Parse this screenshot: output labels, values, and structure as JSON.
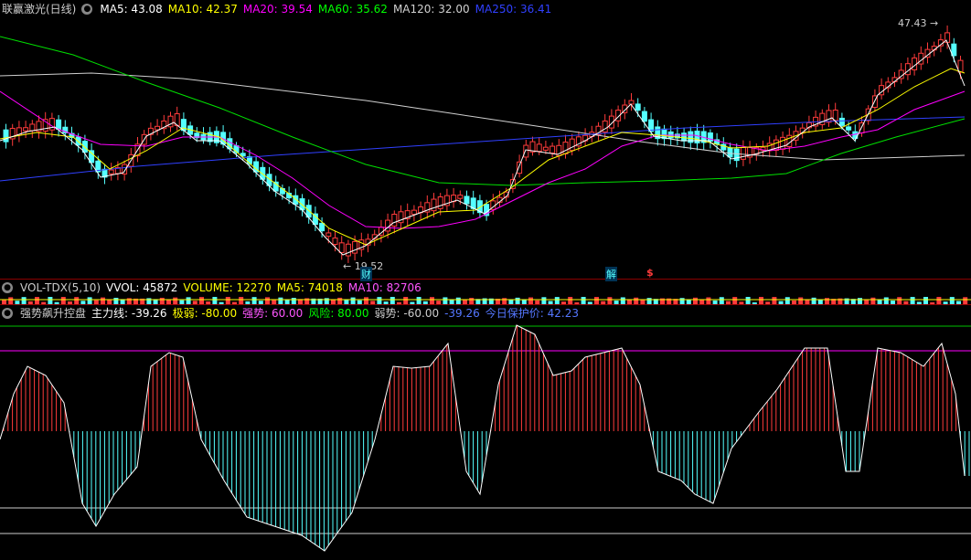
{
  "main_header": {
    "title": "联赢激光(日线)",
    "ma": [
      {
        "label": "MA5: 43.08",
        "color": "#ffffff"
      },
      {
        "label": "MA10: 42.37",
        "color": "#ffff00"
      },
      {
        "label": "MA20: 39.54",
        "color": "#ff00ff"
      },
      {
        "label": "MA60: 35.62",
        "color": "#00ff00"
      },
      {
        "label": "MA120: 32.00",
        "color": "#d0d0d0"
      },
      {
        "label": "MA250: 36.41",
        "color": "#3040ff"
      }
    ]
  },
  "annotations": {
    "high_label": "47.43",
    "low_label": "19.52",
    "marker_cai": "财",
    "marker_jie": "解",
    "marker_s": "$"
  },
  "volume_header": {
    "title": "VOL-TDX(5,10)",
    "items": [
      {
        "label": "VVOL: 45872",
        "color": "#ffffff"
      },
      {
        "label": "VOLUME: 12270",
        "color": "#ffff00"
      },
      {
        "label": "MA5: 74018",
        "color": "#ffff00"
      },
      {
        "label": "MA10: 82706",
        "color": "#ff55ff"
      }
    ]
  },
  "indicator_header": {
    "title": "强势飙升控盘",
    "items": [
      {
        "label": "主力线: -39.26",
        "color": "#ffffff"
      },
      {
        "label": "极弱: -80.00",
        "color": "#ffff00"
      },
      {
        "label": "强势: 60.00",
        "color": "#ff55ff"
      },
      {
        "label": "风险: 80.00",
        "color": "#00ff00"
      },
      {
        "label": "弱势: -60.00",
        "color": "#cccccc"
      },
      {
        "label": "-39.26",
        "color": "#5577ff"
      },
      {
        "label": "今日保护价: 42.23",
        "color": "#5577ff"
      }
    ]
  },
  "colors": {
    "up": "#ff3b3b",
    "down": "#54ffff",
    "separator": "#8b0000"
  }
}
